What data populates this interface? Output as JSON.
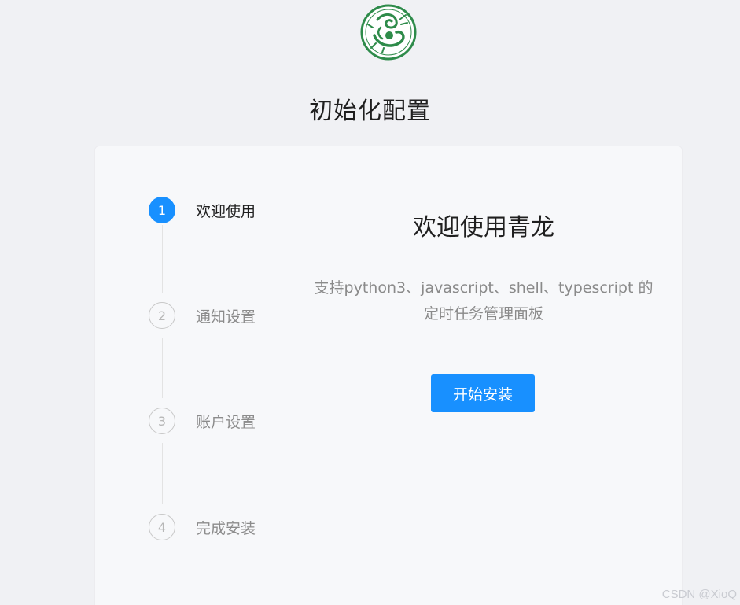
{
  "header": {
    "logo_icon": "qinglong-dragon-logo",
    "title": "初始化配置"
  },
  "steps": [
    {
      "number": "1",
      "label": "欢迎使用",
      "state": "active"
    },
    {
      "number": "2",
      "label": "通知设置",
      "state": "wait"
    },
    {
      "number": "3",
      "label": "账户设置",
      "state": "wait"
    },
    {
      "number": "4",
      "label": "完成安装",
      "state": "wait"
    }
  ],
  "content": {
    "title": "欢迎使用青龙",
    "description_line1": "支持python3、javascript、shell、typescript 的",
    "description_line2": "定时任务管理面板",
    "start_button_label": "开始安装"
  },
  "watermark": "CSDN @XioQ",
  "colors": {
    "primary": "#1890ff",
    "logo_green": "#2e8b4a",
    "background": "#f0f1f4",
    "card": "#f7f8fa"
  }
}
